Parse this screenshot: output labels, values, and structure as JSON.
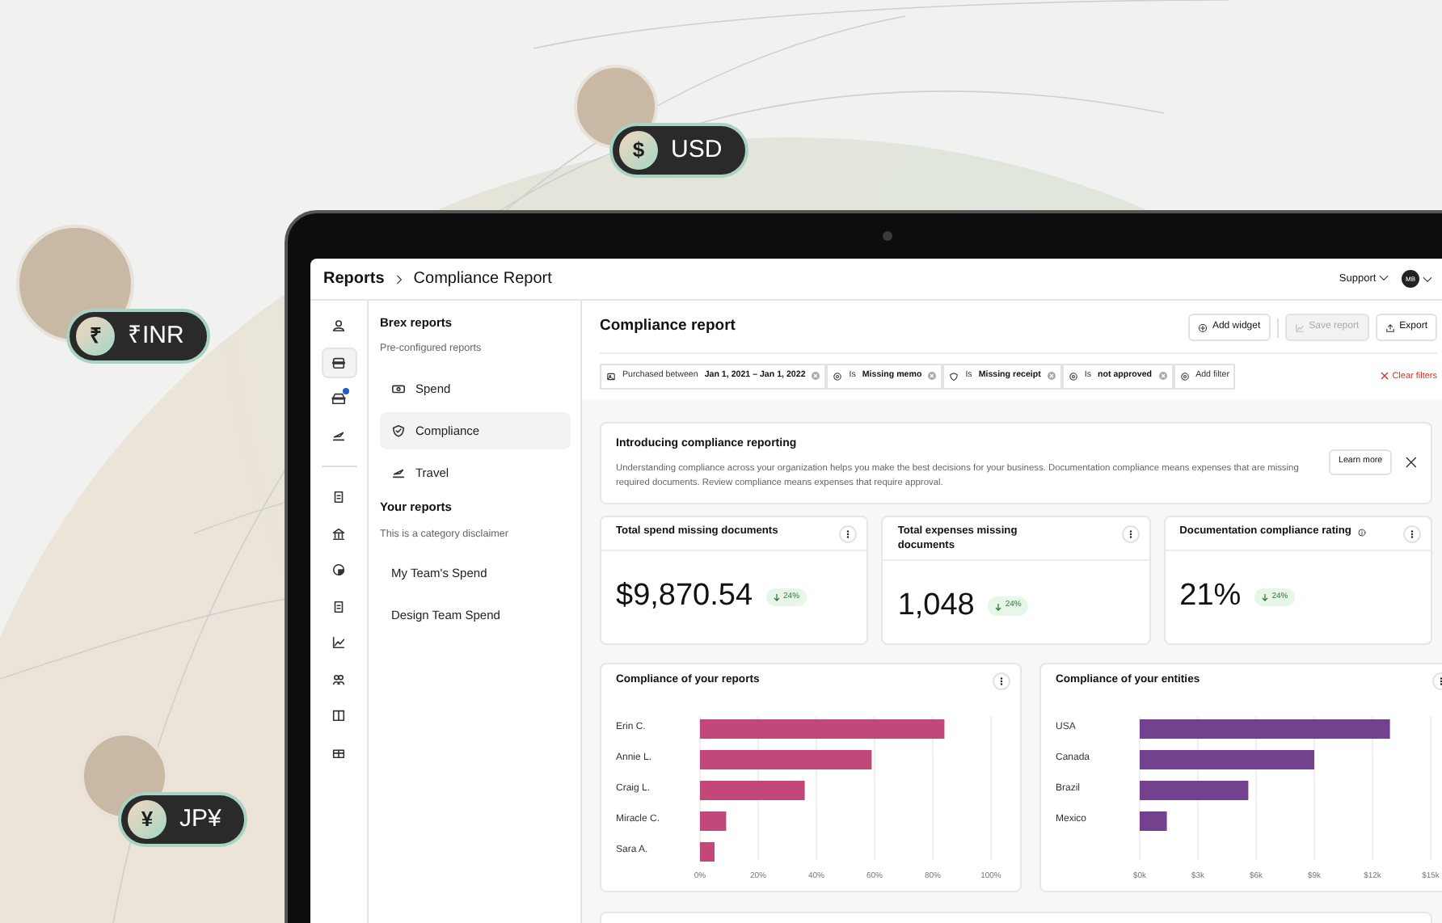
{
  "badges": [
    {
      "symbol": "$",
      "label": "USD"
    },
    {
      "symbol": "₹",
      "label": "₹INR"
    },
    {
      "symbol": "¥",
      "label": "JP¥"
    }
  ],
  "app": {
    "breadcrumb": [
      "Reports",
      "Compliance Report"
    ],
    "support": "Support",
    "user_initials": "MB",
    "rail_groups": [
      [
        {
          "selected": false,
          "notification": false
        },
        {
          "selected": true,
          "notification": false
        },
        {
          "selected": false,
          "notification": true
        },
        {
          "selected": false,
          "notification": false
        }
      ],
      [
        {
          "selected": false,
          "notification": false
        },
        {
          "selected": false,
          "notification": false
        },
        {
          "selected": false,
          "notification": false
        },
        {
          "selected": false,
          "notification": false
        },
        {
          "selected": false,
          "notification": false
        },
        {
          "selected": false,
          "notification": false
        },
        {
          "selected": false,
          "notification": false
        },
        {
          "selected": false,
          "notification": false
        }
      ]
    ],
    "sidebar": [
      {
        "title": "Brex reports",
        "subtitle": "Pre-configured reports",
        "kind": "icons",
        "items": [
          {
            "label": "Spend",
            "selected": false
          },
          {
            "label": "Compliance",
            "selected": true
          },
          {
            "label": "Travel",
            "selected": false
          }
        ]
      },
      {
        "title": "Your reports",
        "subtitle": "This is a category disclaimer",
        "kind": "plain",
        "items": [
          {
            "label": "My Team's Spend",
            "selected": false
          },
          {
            "label": "Design Team Spend",
            "selected": false
          }
        ]
      }
    ],
    "main": {
      "title": "Compliance report",
      "buttons": [
        {
          "kind": "add",
          "label": "Add widget",
          "disabled": false
        },
        {
          "kind": "chart",
          "label": "Save report",
          "disabled": true
        },
        {
          "kind": "export",
          "label": "Export",
          "disabled": false
        }
      ],
      "filters": [
        {
          "kind": "date",
          "label": "Purchased between",
          "value": "Jan 1, 2021 – Jan 1, 2022"
        },
        {
          "kind": "condition",
          "label": "Is",
          "value": "Missing memo"
        },
        {
          "kind": "shield",
          "label": "Is",
          "value": "Missing receipt"
        },
        {
          "kind": "condition",
          "label": "Is",
          "value": "not approved"
        }
      ],
      "add_filter": "Add filter",
      "clear_filters": "Clear filters",
      "intro": {
        "title": "Introducing compliance reporting",
        "text": "Understanding compliance across your organization helps you make the best decisions for your business. Documentation compliance means expenses that are missing required documents. Review compliance means expenses that require approval.",
        "button": "Learn more"
      },
      "metrics": [
        {
          "title": "Total spend missing documents",
          "value": "$9,870.54",
          "change": "24%",
          "info": false
        },
        {
          "title": "Total expenses missing documents",
          "value": "1,048",
          "change": "24%",
          "info": false
        },
        {
          "title": "Documentation compliance rating",
          "value": "21%",
          "change": "24%",
          "info": true
        }
      ],
      "charts": [
        {
          "title": "Compliance of your reports",
          "chart_data": {
            "type": "bar",
            "orientation": "horizontal",
            "categories": [
              "Erin C.",
              "Annie L.",
              "Craig L.",
              "Miracle C.",
              "Sara A."
            ],
            "grid": true,
            "series": [
              {
                "color": "#c2487a",
                "values": [
                  84,
                  59,
                  36,
                  9,
                  5
                ]
              }
            ],
            "xlim": [
              0,
              100
            ],
            "xticks": [
              {
                "value": 0,
                "label": "0%"
              },
              {
                "value": 20,
                "label": "20%"
              },
              {
                "value": 40,
                "label": "40%"
              },
              {
                "value": 60,
                "label": "60%"
              },
              {
                "value": 80,
                "label": "80%"
              },
              {
                "value": 100,
                "label": "100%"
              }
            ]
          }
        },
        {
          "title": "Compliance of your entities",
          "chart_data": {
            "type": "bar",
            "orientation": "horizontal",
            "categories": [
              "USA",
              "Canada",
              "Brazil",
              "Mexico"
            ],
            "grid": true,
            "series": [
              {
                "color": "#74418f",
                "values": [
                  12.9,
                  9.0,
                  5.6,
                  1.4
                ]
              }
            ],
            "xlim": [
              0,
              15
            ],
            "xticks": [
              {
                "value": 0,
                "label": "$0k"
              },
              {
                "value": 3,
                "label": "$3k"
              },
              {
                "value": 6,
                "label": "$6k"
              },
              {
                "value": 9,
                "label": "$9k"
              },
              {
                "value": 12,
                "label": "$12k"
              },
              {
                "value": 15,
                "label": "$15k"
              }
            ]
          }
        }
      ]
    }
  }
}
